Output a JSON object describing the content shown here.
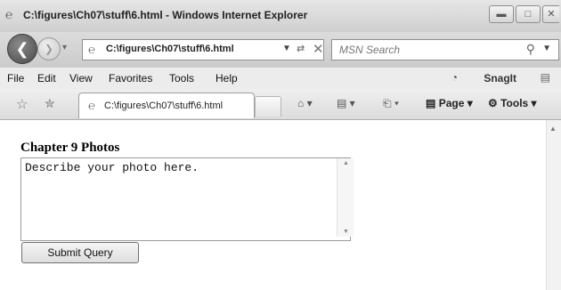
{
  "window": {
    "title": "C:\\figures\\Ch07\\stuff\\6.html - Windows Internet Explorer",
    "controls": [
      "minimize",
      "maximize",
      "close"
    ]
  },
  "navigation": {
    "address": "C:\\figures\\Ch07\\stuff\\6.html",
    "search_placeholder": "MSN Search"
  },
  "menu": {
    "items": [
      "File",
      "Edit",
      "View",
      "Favorites",
      "Tools",
      "Help"
    ],
    "snagit_label": "SnagIt"
  },
  "tabs": {
    "active_tab": "C:\\figures\\Ch07\\stuff\\6.html"
  },
  "toolbar": {
    "page_label": "Page",
    "tools_label": "Tools"
  },
  "page": {
    "heading": "Chapter 9 Photos",
    "textarea_value": "Describe your photo here.",
    "submit_label": "Submit Query"
  },
  "icons": {
    "ie": "ie-icon",
    "back": "back-arrow-icon",
    "forward": "forward-arrow-icon",
    "refresh": "refresh-icon",
    "stop": "stop-icon",
    "search": "search-icon",
    "favorites": "star-icon",
    "add_favorite": "add-favorite-icon",
    "home": "home-icon",
    "feeds": "feeds-icon",
    "print": "print-icon"
  }
}
